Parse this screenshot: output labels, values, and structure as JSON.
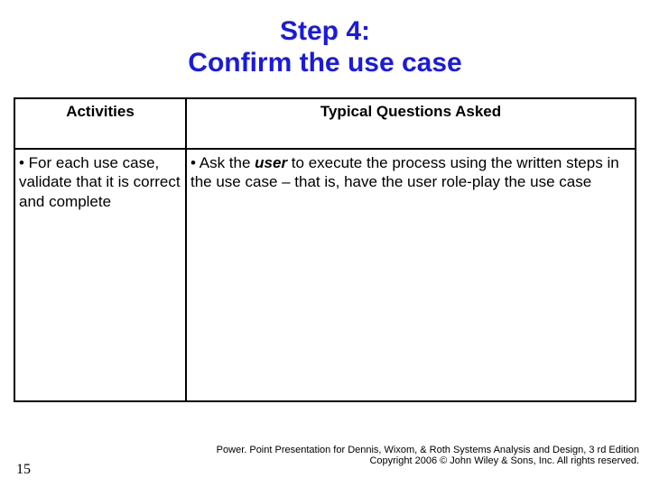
{
  "title": {
    "line1": "Step 4:",
    "line2": "Confirm the use case"
  },
  "table": {
    "headers": {
      "col1": "Activities",
      "col2": "Typical Questions Asked"
    },
    "row": {
      "activities": "• For each use case, validate that it is correct and complete",
      "questions_prefix": "• Ask the ",
      "questions_user": "user",
      "questions_suffix": " to execute the process using the written steps in the use case – that is, have the user role-play the use case"
    }
  },
  "footer": {
    "line1": "Power. Point Presentation for Dennis, Wixom, & Roth Systems Analysis and Design, 3 rd Edition",
    "line2": "Copyright 2006 © John Wiley & Sons, Inc. All rights reserved."
  },
  "page_number": "15"
}
